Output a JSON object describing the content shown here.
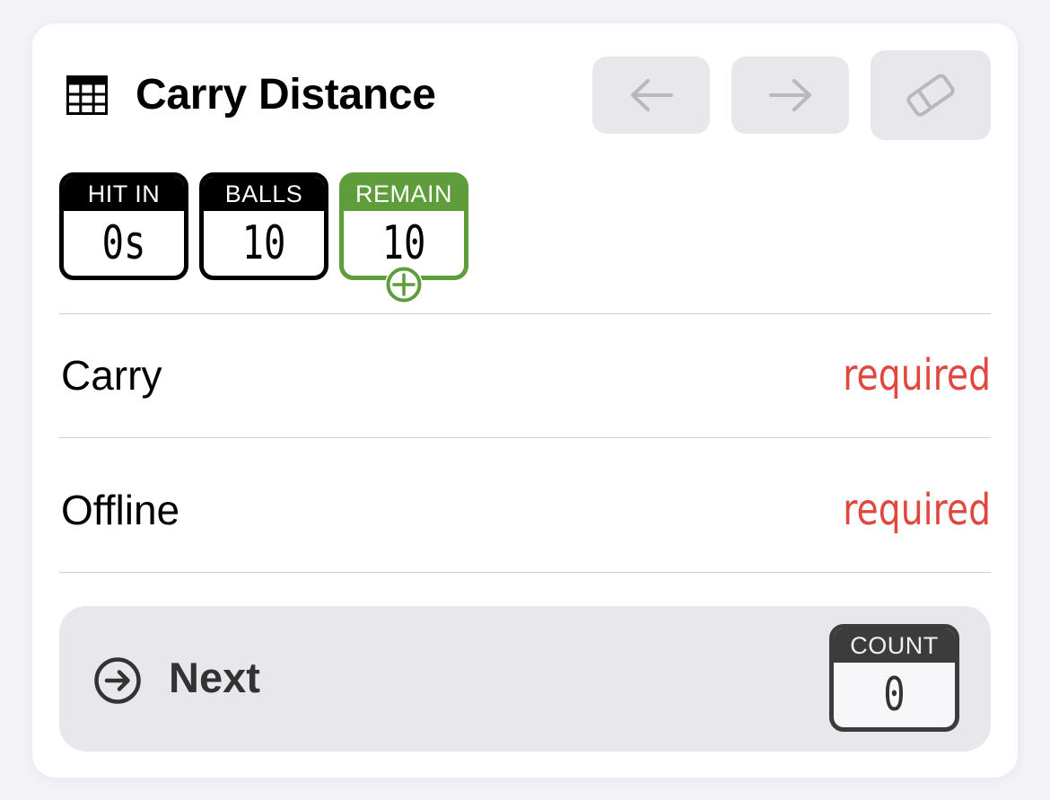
{
  "header": {
    "icon": "grid-icon",
    "title": "Carry Distance",
    "back_icon": "arrow-left-icon",
    "forward_icon": "arrow-right-icon",
    "erase_icon": "eraser-icon"
  },
  "badges": {
    "hit_in": {
      "label": "HIT IN",
      "value": "0s"
    },
    "balls": {
      "label": "BALLS",
      "value": "10"
    },
    "remain": {
      "label": "REMAIN",
      "value": "10",
      "color": "#5f9c3b"
    }
  },
  "fields": [
    {
      "label": "Carry",
      "status": "required"
    },
    {
      "label": "Offline",
      "status": "required"
    }
  ],
  "next": {
    "label": "Next",
    "icon": "arrow-right-circle-icon",
    "count_label": "COUNT",
    "count_value": "0"
  },
  "colors": {
    "required": "#e0483e",
    "remain_accent": "#5f9c3b",
    "button_bg": "#e8e8ec"
  }
}
